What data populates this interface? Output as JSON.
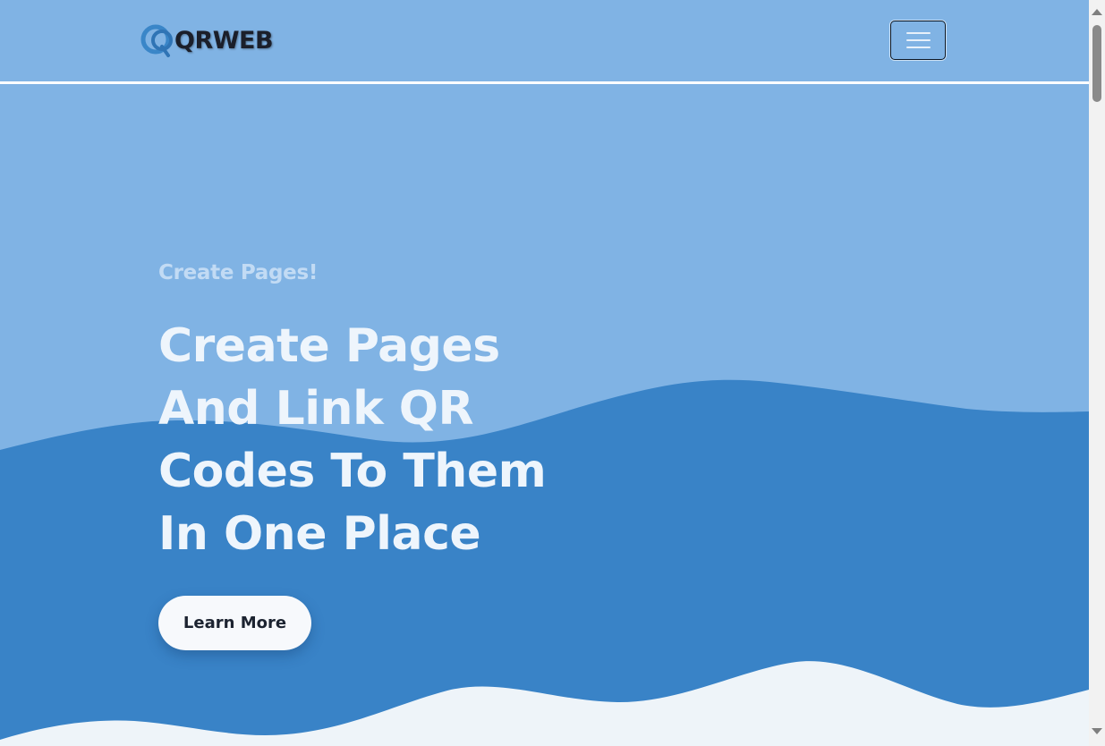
{
  "navbar": {
    "brand_text": "QRWEB",
    "toggle_icon": "hamburger-menu-icon"
  },
  "hero": {
    "eyebrow": "Create Pages!",
    "headline_lines": [
      "Create Pages",
      "And Link QR",
      "Codes To Them",
      "In One Place"
    ],
    "cta_label": "Learn More"
  },
  "colors": {
    "hero_bg": "#80b3e4",
    "wave_mid": "#3983c7",
    "wave_bottom": "#eef4f9",
    "headline": "#eef5fc",
    "eyebrow": "#c2dbf4",
    "brand_mark": "#3a86c8",
    "cta_bg": "#f7f9fc"
  },
  "scrollbar": {
    "icons": [
      "scroll-up-arrow-icon",
      "scroll-down-arrow-icon"
    ]
  }
}
